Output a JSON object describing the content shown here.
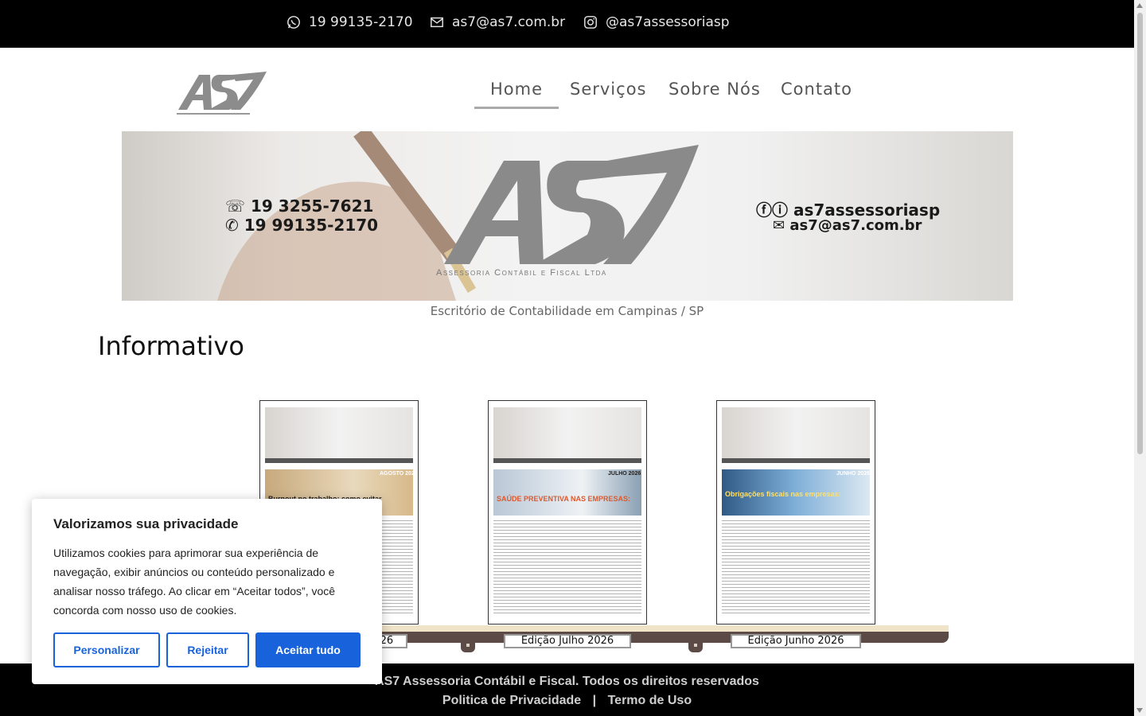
{
  "topbar": {
    "phone": "19 99135-2170",
    "email": "as7@as7.com.br",
    "instagram": "@as7assessoriasp"
  },
  "nav": {
    "items": [
      "Home",
      "Serviços",
      "Sobre Nós",
      "Contato"
    ],
    "active": "Home"
  },
  "banner": {
    "phone1": "19 3255-7621",
    "phone2": "19 99135-2170",
    "social": "as7assessoriasp",
    "email": "as7@as7.com.br",
    "subtitle": "Assessoria Contábil e Fiscal Ltda"
  },
  "tagline": "Escritório de Contabilidade em Campinas / SP",
  "section_title": "Informativo",
  "newsletters": [
    {
      "label": "Edição Agosto 2026",
      "month": "AGOSTO 2026",
      "headline": "Burnout no trabalho: como evitar"
    },
    {
      "label": "Edição Julho 2026",
      "month": "JULHO 2026",
      "headline": "SAÚDE PREVENTIVA NAS EMPRESAS:"
    },
    {
      "label": "Edição Junho 2026",
      "month": "JUNHO 2026",
      "headline": "Obrigações fiscais nas empresas:"
    }
  ],
  "footer": {
    "line1": "AS7 Assessoria Contábil e Fiscal.  Todos os direitos reservados",
    "privacy": "Politica de Privacidade",
    "separator": "|",
    "terms": "Termo de Uso"
  },
  "cookie": {
    "title": "Valorizamos sua privacidade",
    "description": "Utilizamos cookies para aprimorar sua experiência de navegação, exibir anúncios ou conteúdo personalizado e analisar nosso tráfego. Ao clicar em “Aceitar todos”, você concorda com nosso uso de cookies.",
    "customize": "Personalizar",
    "reject": "Rejeitar",
    "accept": "Aceitar tudo"
  },
  "colors": {
    "accent": "#1863dc",
    "topbar": "#000000",
    "shelf": "#5b4a45"
  }
}
